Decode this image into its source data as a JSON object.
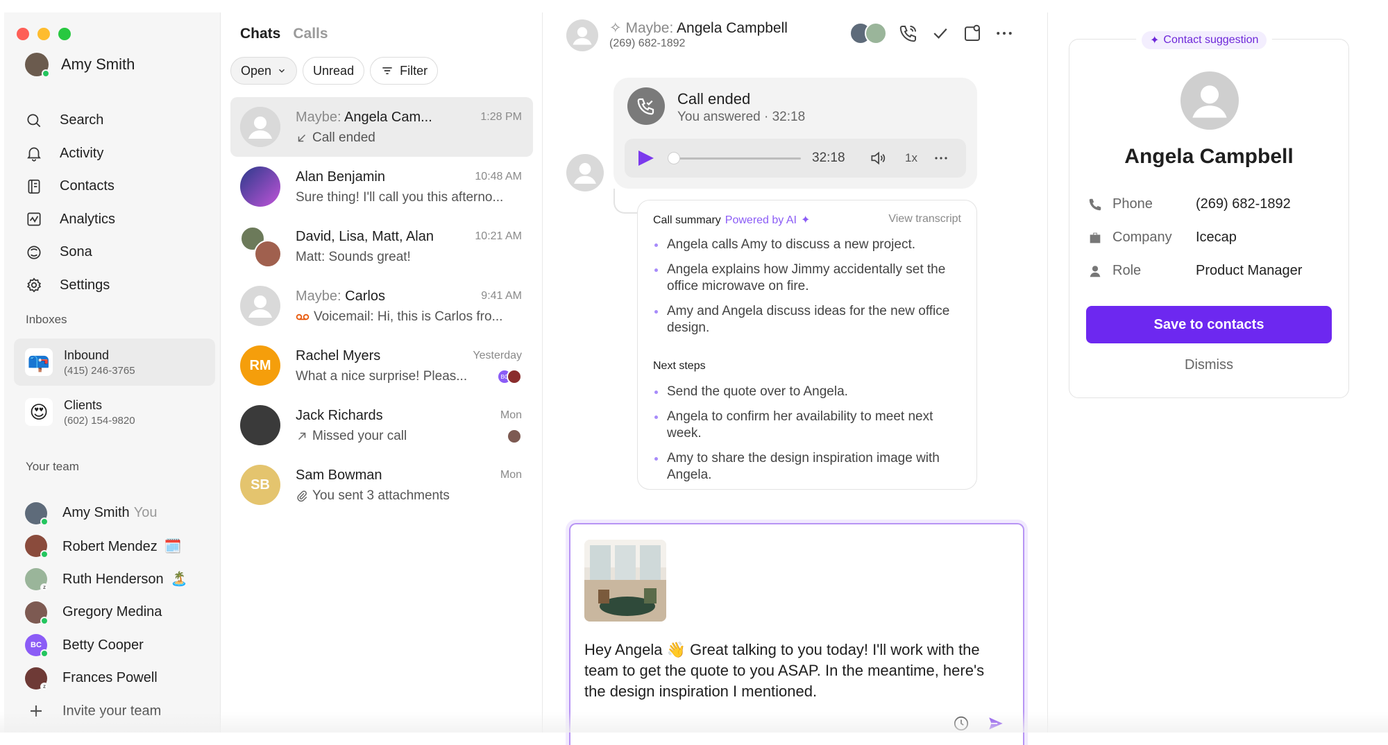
{
  "user": {
    "name": "Amy Smith"
  },
  "nav": [
    {
      "label": "Search",
      "icon": "search-icon"
    },
    {
      "label": "Activity",
      "icon": "bell-icon"
    },
    {
      "label": "Contacts",
      "icon": "contacts-icon"
    },
    {
      "label": "Analytics",
      "icon": "analytics-icon"
    },
    {
      "label": "Sona",
      "icon": "sona-icon"
    },
    {
      "label": "Settings",
      "icon": "gear-icon"
    }
  ],
  "inboxes_label": "Inboxes",
  "inboxes": [
    {
      "name": "Inbound",
      "number": "(415) 246-3765",
      "emoji": "📪"
    },
    {
      "name": "Clients",
      "number": "(602) 154-9820",
      "emoji": "😍"
    }
  ],
  "team_label": "Your team",
  "team": [
    {
      "name": "Amy Smith",
      "you": "You",
      "status": ""
    },
    {
      "name": "Robert Mendez",
      "status": "🗓️"
    },
    {
      "name": "Ruth Henderson",
      "status": "🏝️"
    },
    {
      "name": "Gregory Medina",
      "status": ""
    },
    {
      "name": "Betty Cooper",
      "initials": "BC",
      "status": ""
    },
    {
      "name": "Frances Powell",
      "status": ""
    }
  ],
  "invite_label": "Invite your team",
  "list": {
    "tab_chats": "Chats",
    "tab_calls": "Calls",
    "filter_open": "Open",
    "filter_unread": "Unread",
    "filter_filter": "Filter"
  },
  "chats": [
    {
      "maybe": "Maybe:",
      "name": "Angela Cam...",
      "time": "1:28 PM",
      "preview": "Call ended"
    },
    {
      "maybe": "",
      "name": "Alan Benjamin",
      "time": "10:48 AM",
      "preview": "Sure thing! I'll call you this afterno..."
    },
    {
      "maybe": "",
      "name": "David, Lisa, Matt, Alan",
      "time": "10:21 AM",
      "preview": "Matt: Sounds great!"
    },
    {
      "maybe": "Maybe:",
      "name": "Carlos",
      "time": "9:41 AM",
      "preview": "Voicemail: Hi, this is Carlos fro..."
    },
    {
      "maybe": "",
      "name": "Rachel Myers",
      "initials": "RM",
      "time": "Yesterday",
      "preview": "What a nice surprise! Pleas...",
      "badge": "BC"
    },
    {
      "maybe": "",
      "name": "Jack Richards",
      "time": "Mon",
      "preview": "Missed your call"
    },
    {
      "maybe": "",
      "name": "Sam Bowman",
      "initials": "SB",
      "time": "Mon",
      "preview": "You sent 3 attachments"
    }
  ],
  "conversation": {
    "maybe": "Maybe:",
    "name": "Angela Campbell",
    "phone": "(269) 682-1892",
    "call_title": "Call ended",
    "call_sub": "You answered · 32:18",
    "duration": "32:18",
    "speed": "1x",
    "summary_title": "Call summary",
    "summary_ai": "Powered by AI",
    "view_transcript": "View transcript",
    "summary_points": [
      "Angela calls Amy to discuss a new project.",
      "Angela explains how Jimmy accidentally set the office microwave on fire.",
      "Amy and Angela discuss ideas for the new office design."
    ],
    "next_steps_title": "Next steps",
    "next_steps": [
      "Send the quote over to Angela.",
      "Angela to confirm her availability to meet next week.",
      "Amy to share the design inspiration image with Angela."
    ],
    "draft": "Hey Angela 👋 Great talking to you today! I'll work with the team to get the quote to you ASAP. In the meantime, here's the design inspiration I mentioned."
  },
  "contact": {
    "suggestion_label": "Contact suggestion",
    "name": "Angela Campbell",
    "phone_label": "Phone",
    "phone": "(269) 682-1892",
    "company_label": "Company",
    "company": "Icecap",
    "role_label": "Role",
    "role": "Product Manager",
    "save_label": "Save to contacts",
    "dismiss_label": "Dismiss"
  },
  "colors": {
    "accent": "#6d28f0",
    "ai": "#8b5cf6",
    "online": "#23c55e"
  }
}
